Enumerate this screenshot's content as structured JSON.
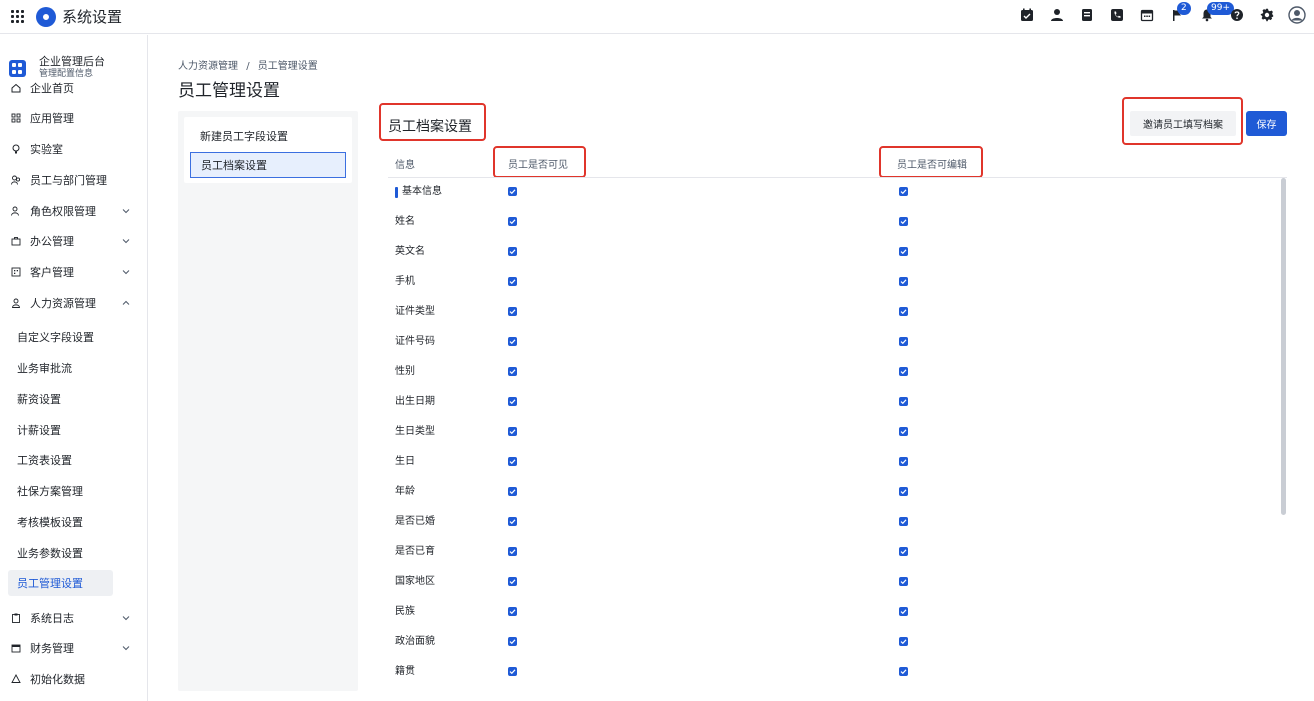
{
  "header": {
    "app_title": "系统设置",
    "badges": {
      "flag": "2",
      "bell": "99+"
    }
  },
  "sidebar": {
    "enterprise_name": "企业管理后台",
    "enterprise_sub": "管理配置信息",
    "items": [
      {
        "label": "企业首页"
      },
      {
        "label": "应用管理"
      },
      {
        "label": "实验室"
      },
      {
        "label": "员工与部门管理"
      },
      {
        "label": "角色权限管理"
      },
      {
        "label": "办公管理"
      },
      {
        "label": "客户管理"
      },
      {
        "label": "人力资源管理"
      }
    ],
    "hr_sub_items": [
      {
        "label": "自定义字段设置"
      },
      {
        "label": "业务审批流"
      },
      {
        "label": "薪资设置"
      },
      {
        "label": "计薪设置"
      },
      {
        "label": "工资表设置"
      },
      {
        "label": "社保方案管理"
      },
      {
        "label": "考核模板设置"
      },
      {
        "label": "业务参数设置"
      },
      {
        "label": "员工管理设置"
      }
    ],
    "bottom_items": [
      {
        "label": "系统日志"
      },
      {
        "label": "财务管理"
      },
      {
        "label": "初始化数据"
      }
    ]
  },
  "breadcrumb": {
    "parent": "人力资源管理",
    "separator": "/",
    "current": "员工管理设置"
  },
  "page_title": "员工管理设置",
  "left_panel": {
    "items": [
      {
        "label": "新建员工字段设置"
      },
      {
        "label": "员工档案设置"
      }
    ]
  },
  "section": {
    "title": "员工档案设置",
    "invite_button": "邀请员工填写档案",
    "save_button": "保存"
  },
  "table": {
    "headers": {
      "info": "信息",
      "visible": "员工是否可见",
      "editable": "员工是否可编辑"
    },
    "rows": [
      {
        "label": "基本信息",
        "group": true,
        "visible": true,
        "editable": true
      },
      {
        "label": "姓名",
        "visible": true,
        "editable": true
      },
      {
        "label": "英文名",
        "visible": true,
        "editable": true
      },
      {
        "label": "手机",
        "visible": true,
        "editable": true
      },
      {
        "label": "证件类型",
        "visible": true,
        "editable": true
      },
      {
        "label": "证件号码",
        "visible": true,
        "editable": true
      },
      {
        "label": "性别",
        "visible": true,
        "editable": true
      },
      {
        "label": "出生日期",
        "visible": true,
        "editable": true
      },
      {
        "label": "生日类型",
        "visible": true,
        "editable": true
      },
      {
        "label": "生日",
        "visible": true,
        "editable": true
      },
      {
        "label": "年龄",
        "visible": true,
        "editable": true
      },
      {
        "label": "是否已婚",
        "visible": true,
        "editable": true
      },
      {
        "label": "是否已育",
        "visible": true,
        "editable": true
      },
      {
        "label": "国家地区",
        "visible": true,
        "editable": true
      },
      {
        "label": "民族",
        "visible": true,
        "editable": true
      },
      {
        "label": "政治面貌",
        "visible": true,
        "editable": true
      },
      {
        "label": "籍贯",
        "visible": true,
        "editable": true
      }
    ]
  },
  "colors": {
    "primary": "#1f5ad6",
    "highlight": "#e0352b",
    "active_bg": "#e7effd"
  }
}
